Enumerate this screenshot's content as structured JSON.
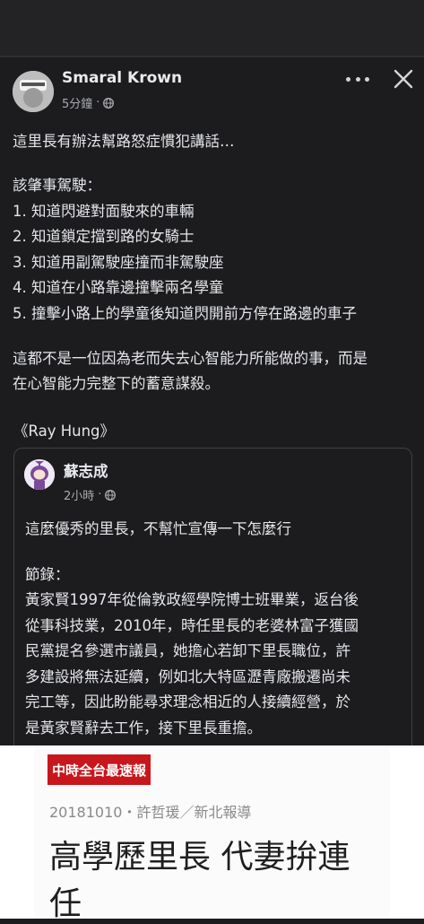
{
  "post": {
    "author": "Smaral Krown",
    "time": "5分鐘",
    "dot": "·",
    "paragraph1": "這里長有辦法幫路怒症慣犯講話…",
    "list_heading": "該肇事駕駛：",
    "list": [
      "1. 知道閃避對面駛來的車輛",
      "2. 知道鎖定擋到路的女騎士",
      "3. 知道用副駕駛座撞而非駕駛座",
      "4. 知道在小路靠邊撞擊兩名學童",
      "5. 撞擊小路上的學童後知道閃開前方停在路邊的車子"
    ],
    "conclusion_line1": "這都不是一位因為老而失去心智能力所能做的事，而是",
    "conclusion_line2": "在心智能力完整下的蓄意謀殺。",
    "signature": "《Ray Hung》"
  },
  "shared": {
    "author": "蘇志成",
    "time": "2小時",
    "dot": "·",
    "line1": "這麼優秀的里長，不幫忙宣傳一下怎麼行",
    "excerpt_label": "節錄：",
    "excerpt": [
      "黃家賢1997年從倫敦政經學院博士班畢業，返台後",
      "從事科技業，2010年，時任里長的老婆林富子獲國",
      "民黨提名參選市議員，她擔心若卸下里長職位，許",
      "多建設將無法延續，例如北大特區瀝青廠搬遷尚未",
      "完工等，因此盼能尋求理念相近的人接續經營，於",
      "是黃家賢辭去工作，接下里長重擔。"
    ]
  },
  "article": {
    "badge": "中時全台最速報",
    "dateline": "20181010・許哲瑗／新北報導",
    "title_line1": "高學歷里長 代妻拚連",
    "title_line2": "任"
  },
  "colors": {
    "background": "#1c1c1e",
    "text": "#e4e6eb",
    "meta": "#a8abb0",
    "badge": "#c8161d"
  },
  "icons": [
    "more-icon",
    "close-icon",
    "globe-icon"
  ]
}
